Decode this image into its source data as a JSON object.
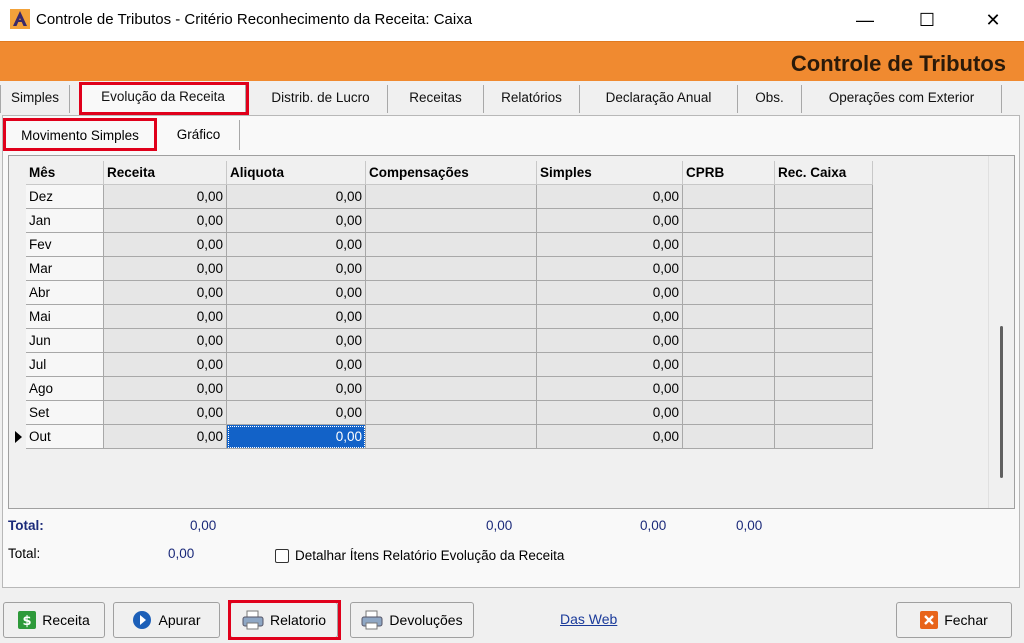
{
  "window": {
    "title": "Controle de Tributos - Critério Reconhecimento da Receita:  Caixa",
    "minimize": "—",
    "maximize": "☐",
    "close": "✕"
  },
  "banner": {
    "title": "Controle de Tributos",
    "color": "#f08a30"
  },
  "tabs": [
    {
      "label": "Simples"
    },
    {
      "label": "Evolução da Receita"
    },
    {
      "label": "Distrib. de Lucro"
    },
    {
      "label": "Receitas"
    },
    {
      "label": "Relatórios"
    },
    {
      "label": "Declaração Anual"
    },
    {
      "label": "Obs."
    },
    {
      "label": "Operações com Exterior"
    }
  ],
  "subtabs": [
    {
      "label": "Movimento Simples"
    },
    {
      "label": "Gráfico"
    }
  ],
  "grid": {
    "columns": [
      "Mês",
      "Receita",
      "Aliquota",
      "Compensações",
      "Simples",
      "CPRB",
      "Rec. Caixa"
    ],
    "rows": [
      [
        "Dez",
        "0,00",
        "0,00",
        "",
        "0,00",
        "",
        ""
      ],
      [
        "Jan",
        "0,00",
        "0,00",
        "",
        "0,00",
        "",
        ""
      ],
      [
        "Fev",
        "0,00",
        "0,00",
        "",
        "0,00",
        "",
        ""
      ],
      [
        "Mar",
        "0,00",
        "0,00",
        "",
        "0,00",
        "",
        ""
      ],
      [
        "Abr",
        "0,00",
        "0,00",
        "",
        "0,00",
        "",
        ""
      ],
      [
        "Mai",
        "0,00",
        "0,00",
        "",
        "0,00",
        "",
        ""
      ],
      [
        "Jun",
        "0,00",
        "0,00",
        "",
        "0,00",
        "",
        ""
      ],
      [
        "Jul",
        "0,00",
        "0,00",
        "",
        "0,00",
        "",
        ""
      ],
      [
        "Ago",
        "0,00",
        "0,00",
        "",
        "0,00",
        "",
        ""
      ],
      [
        "Set",
        "0,00",
        "0,00",
        "",
        "0,00",
        "",
        ""
      ],
      [
        "Out",
        "0,00",
        "0,00",
        "",
        "0,00",
        "",
        ""
      ]
    ],
    "selected_row": 10,
    "selected_cell_value": "0,00"
  },
  "totals": {
    "label1": "Total:",
    "receita": "0,00",
    "compensacoes": "0,00",
    "simples": "0,00",
    "cprb": "0,00",
    "label2": "Total:",
    "value2": "0,00",
    "detail_checkbox_label": "Detalhar Ítens Relatório Evolução da Receita"
  },
  "buttons": {
    "receita": "Receita",
    "apurar": "Apurar",
    "relatorio": "Relatorio",
    "devolucoes": "Devoluções",
    "das_web": "Das Web",
    "fechar": "Fechar"
  },
  "icons": {
    "app": "app-a-icon",
    "receita": "dollar-icon",
    "apurar": "play-circle-icon",
    "relatorio": "printer-icon",
    "devolucoes": "printer-icon",
    "fechar": "close-x-icon"
  }
}
